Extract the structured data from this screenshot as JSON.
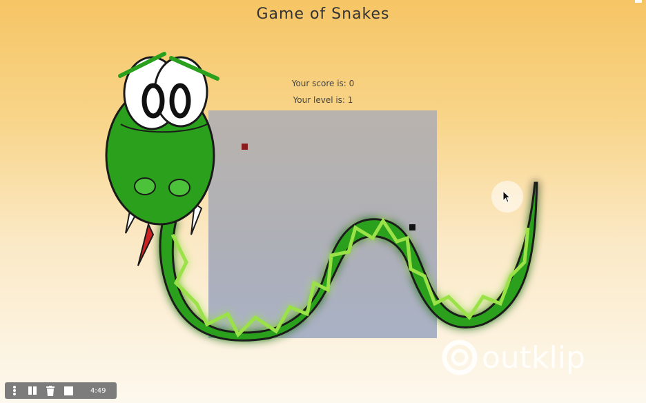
{
  "game": {
    "title": "Game of Snakes",
    "score_text": "Your score is: 0",
    "level_text": "Your level is: 1",
    "score": 0,
    "level": 1
  },
  "colors": {
    "board": "#b1b2b9",
    "food_red": "#8b1c1c",
    "food_black": "#111111",
    "snake_green": "#2aa01d"
  },
  "recorder": {
    "time": "4:49",
    "icons": [
      "more-icon",
      "pause-icon",
      "trash-icon",
      "stop-icon"
    ]
  },
  "watermark": {
    "text": "outklip"
  }
}
